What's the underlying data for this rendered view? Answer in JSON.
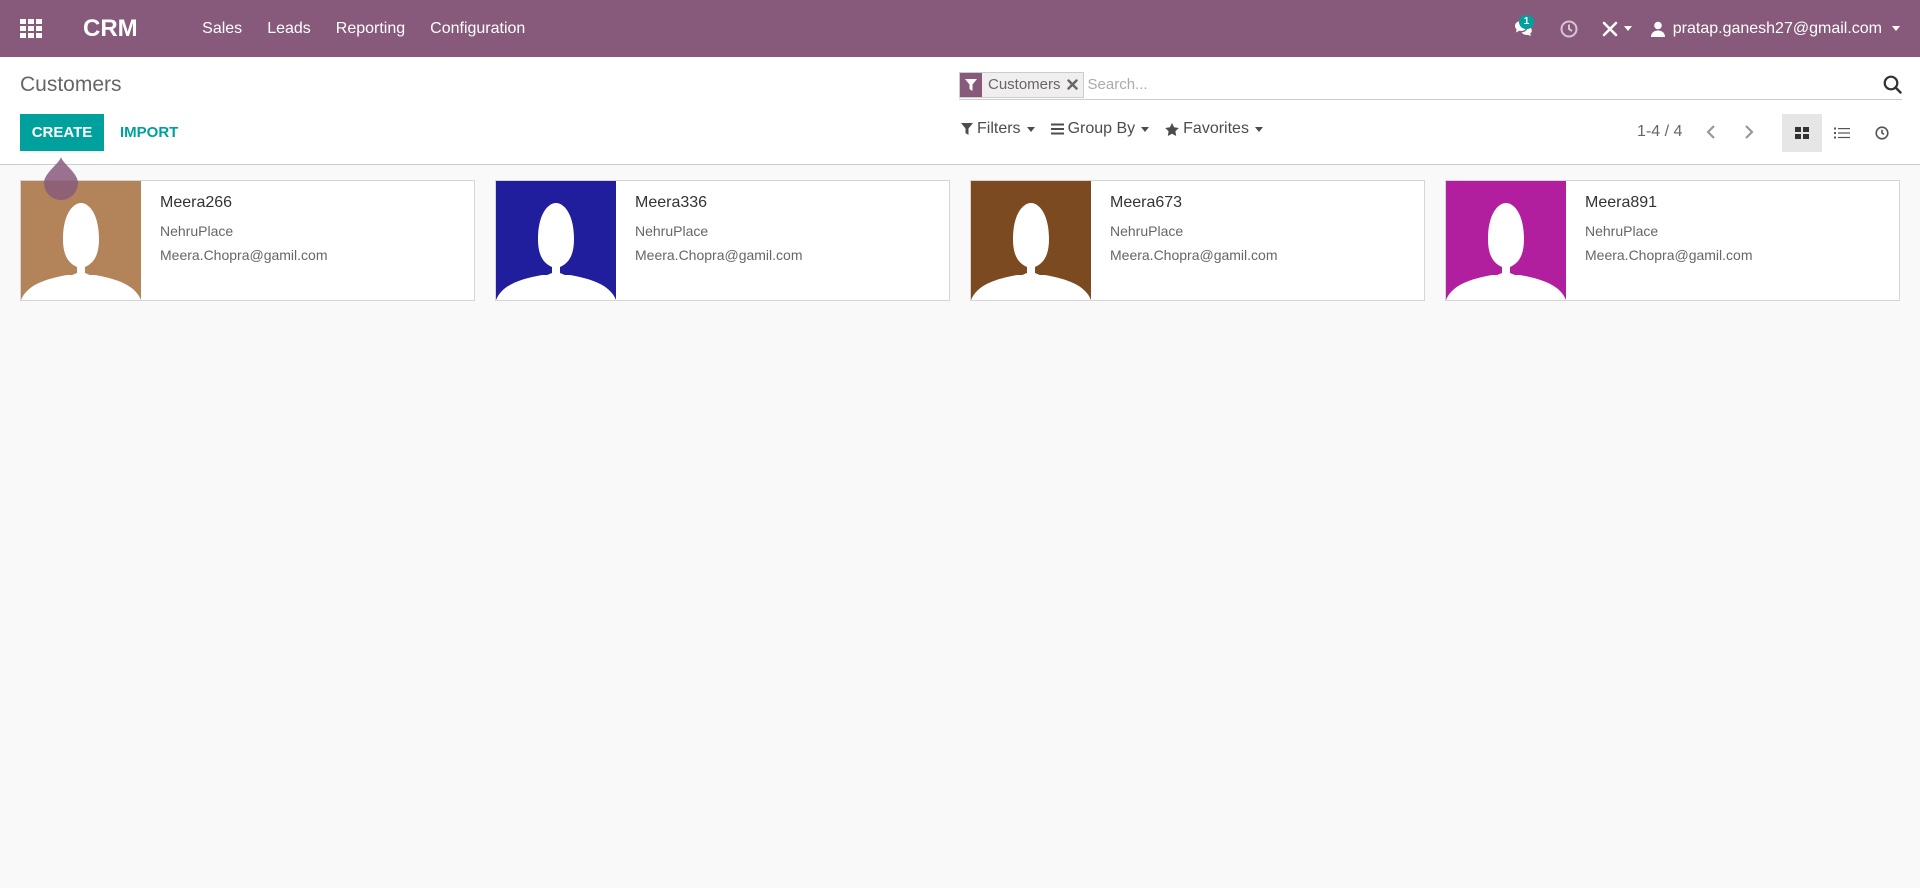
{
  "navbar": {
    "brand": "CRM",
    "menu": [
      {
        "label": "Sales"
      },
      {
        "label": "Leads"
      },
      {
        "label": "Reporting"
      },
      {
        "label": "Configuration"
      }
    ],
    "messages_badge": "1",
    "user": "pratap.ganesh27@gmail.com",
    "bg_color": "#875a7b"
  },
  "control_panel": {
    "title": "Customers",
    "create_label": "CREATE",
    "import_label": "IMPORT",
    "search": {
      "facet": "Customers",
      "placeholder": "Search..."
    },
    "filters_label": "Filters",
    "groupby_label": "Group By",
    "favorites_label": "Favorites",
    "pager": "1-4 / 4",
    "accent_color": "#00a09d"
  },
  "cards": [
    {
      "name": "Meera266",
      "street": "NehruPlace",
      "email": "Meera.Chopra@gamil.com",
      "avatar_color": "#b3845a"
    },
    {
      "name": "Meera336",
      "street": "NehruPlace",
      "email": "Meera.Chopra@gamil.com",
      "avatar_color": "#211e9e"
    },
    {
      "name": "Meera673",
      "street": "NehruPlace",
      "email": "Meera.Chopra@gamil.com",
      "avatar_color": "#7c4a21"
    },
    {
      "name": "Meera891",
      "street": "NehruPlace",
      "email": "Meera.Chopra@gamil.com",
      "avatar_color": "#b11f9f"
    }
  ]
}
